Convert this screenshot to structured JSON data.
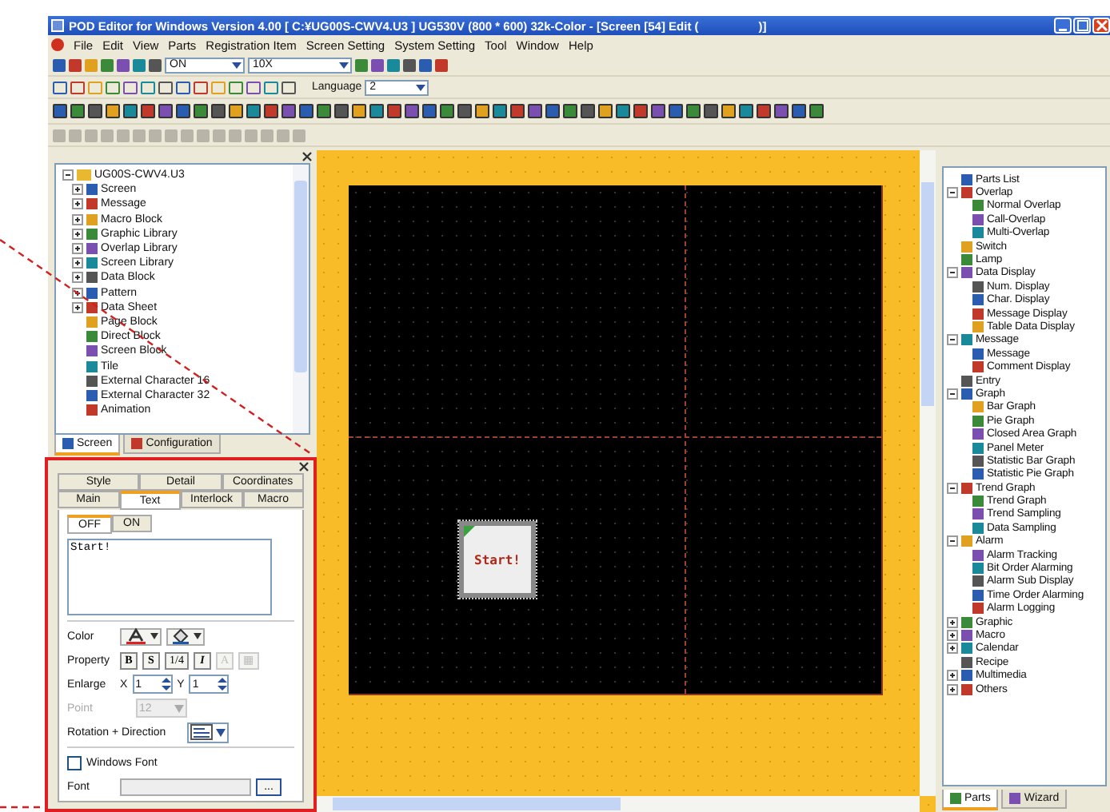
{
  "window": {
    "title": "POD Editor for Windows Version 4.00 [ C:¥UG00S-CWV4.U3 ] UG530V (800 * 600) 32k-Color - [Screen [54] Edit (                  )]"
  },
  "menu": [
    "File",
    "Edit",
    "View",
    "Parts",
    "Registration Item",
    "Screen Setting",
    "System Setting",
    "Tool",
    "Window",
    "Help"
  ],
  "toolbar": {
    "state_select": "ON",
    "zoom_select": "10X",
    "language_label": "Language",
    "language_select": "2"
  },
  "project_tree": {
    "root": "UG00S-CWV4.U3",
    "expanded": true,
    "children": [
      {
        "label": "Screen",
        "expanded": false
      },
      {
        "label": "Message",
        "expanded": false
      },
      {
        "label": "Macro Block",
        "expanded": false
      },
      {
        "label": "Graphic Library",
        "expanded": false
      },
      {
        "label": "Overlap Library",
        "expanded": false
      },
      {
        "label": "Screen Library",
        "expanded": false
      },
      {
        "label": "Data Block",
        "expanded": false
      },
      {
        "label": "Pattern",
        "expanded": false
      },
      {
        "label": "Data Sheet",
        "expanded": false
      },
      {
        "label": "Page Block"
      },
      {
        "label": "Direct Block"
      },
      {
        "label": "Screen Block"
      },
      {
        "label": "Tile"
      },
      {
        "label": "External Character 16"
      },
      {
        "label": "External Character 32"
      },
      {
        "label": "Animation"
      }
    ]
  },
  "left_tabs": [
    {
      "label": "Screen",
      "selected": true
    },
    {
      "label": "Configuration",
      "selected": false
    }
  ],
  "properties": {
    "tabs_back": [
      {
        "label": "Style",
        "selected": false
      },
      {
        "label": "Detail",
        "selected": false
      },
      {
        "label": "Coordinates",
        "selected": false
      }
    ],
    "tabs_front": [
      {
        "label": "Main",
        "selected": false
      },
      {
        "label": "Text",
        "selected": true
      },
      {
        "label": "Interlock",
        "selected": false
      },
      {
        "label": "Macro",
        "selected": false
      }
    ],
    "state_tabs": [
      {
        "label": "OFF",
        "selected": true
      },
      {
        "label": "ON",
        "selected": false
      }
    ],
    "text_value": "Start!",
    "color_label": "Color",
    "property_label": "Property",
    "property_buttons": [
      {
        "label": "B",
        "kind": "bold",
        "disabled": false
      },
      {
        "label": "S",
        "kind": "shadow",
        "disabled": false
      },
      {
        "label": "1/4",
        "kind": "quarter",
        "disabled": false
      },
      {
        "label": "I",
        "kind": "italic",
        "disabled": false
      },
      {
        "label": "A",
        "kind": "outline",
        "disabled": true
      },
      {
        "label": "▦",
        "kind": "fill",
        "disabled": true
      }
    ],
    "enlarge_label": "Enlarge",
    "x_label": "X",
    "x_value": "1",
    "y_label": "Y",
    "y_value": "1",
    "point_label": "Point",
    "point_value": "12",
    "point_disabled": true,
    "rotation_label": "Rotation + Direction",
    "windows_font": {
      "label": "Windows Font",
      "checked": false
    },
    "font_label": "Font",
    "font_button": "..."
  },
  "canvas": {
    "button_label": "Start!"
  },
  "parts_tree": [
    {
      "label": "Parts List"
    },
    {
      "label": "Overlap",
      "expanded": true,
      "children": [
        {
          "label": "Normal Overlap"
        },
        {
          "label": "Call-Overlap"
        },
        {
          "label": "Multi-Overlap"
        }
      ]
    },
    {
      "label": "Switch"
    },
    {
      "label": "Lamp"
    },
    {
      "label": "Data Display",
      "expanded": true,
      "children": [
        {
          "label": "Num. Display"
        },
        {
          "label": "Char. Display"
        },
        {
          "label": "Message Display"
        },
        {
          "label": "Table Data Display"
        }
      ]
    },
    {
      "label": "Message",
      "expanded": true,
      "children": [
        {
          "label": "Message"
        },
        {
          "label": "Comment Display"
        }
      ]
    },
    {
      "label": "Entry"
    },
    {
      "label": "Graph",
      "expanded": true,
      "children": [
        {
          "label": "Bar Graph"
        },
        {
          "label": "Pie Graph"
        },
        {
          "label": "Closed Area Graph"
        },
        {
          "label": "Panel Meter"
        },
        {
          "label": "Statistic Bar Graph"
        },
        {
          "label": "Statistic Pie Graph"
        }
      ]
    },
    {
      "label": "Trend Graph",
      "expanded": true,
      "children": [
        {
          "label": "Trend Graph"
        },
        {
          "label": "Trend Sampling"
        },
        {
          "label": "Data Sampling"
        }
      ]
    },
    {
      "label": "Alarm",
      "expanded": true,
      "children": [
        {
          "label": "Alarm Tracking"
        },
        {
          "label": "Bit Order Alarming"
        },
        {
          "label": "Alarm Sub Display"
        },
        {
          "label": "Time Order Alarming"
        },
        {
          "label": "Alarm Logging"
        }
      ]
    },
    {
      "label": "Graphic",
      "expanded": false
    },
    {
      "label": "Macro",
      "expanded": false
    },
    {
      "label": "Calendar",
      "expanded": false
    },
    {
      "label": "Recipe"
    },
    {
      "label": "Multimedia",
      "expanded": false
    },
    {
      "label": "Others",
      "expanded": false
    }
  ],
  "right_tabs": [
    {
      "label": "Parts",
      "selected": true
    },
    {
      "label": "Wizard",
      "selected": false
    }
  ]
}
